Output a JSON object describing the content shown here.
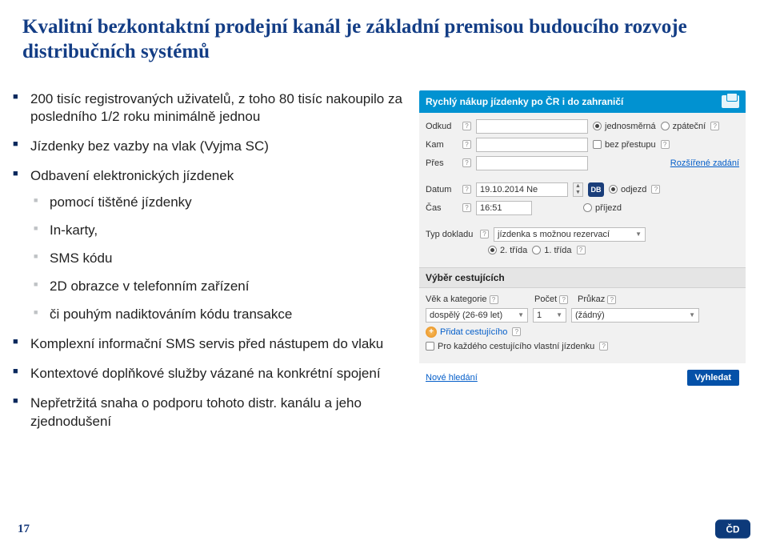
{
  "title": "Kvalitní bezkontaktní  prodejní kanál je základní premisou budoucího rozvoje distribučních systémů",
  "bullets": {
    "b1": "200 tisíc registrovaných uživatelů, z toho 80 tisíc nakoupilo za posledního 1/2 roku minimálně jednou",
    "b2": "Jízdenky bez vazby na vlak (Vyjma SC)",
    "b3": "Odbavení elektronických jízdenek",
    "sub": {
      "s1": "pomocí tištěné jízdenky",
      "s2": "In-karty,",
      "s3": "SMS kódu",
      "s4": "2D obrazce v telefonním zařízení",
      "s5": "či pouhým nadiktováním kódu transakce"
    },
    "b4": "Komplexní informační SMS servis před nástupem do vlaku",
    "b5": "Kontextové doplňkové služby vázané na konkrétní spojení",
    "b6": "Nepřetržitá snaha o podporu tohoto distr. kanálu a jeho zjednodušení"
  },
  "form": {
    "header": "Rychlý nákup jízdenky po ČR i do zahraničí",
    "labels": {
      "odkud": "Odkud",
      "kam": "Kam",
      "pres": "Přes",
      "datum": "Datum",
      "cas": "Čas",
      "typ": "Typ dokladu",
      "vek": "Věk a kategorie",
      "pocet": "Počet",
      "prukaz": "Průkaz"
    },
    "options": {
      "jednosmerna": "jednosměrná",
      "zpatecni": "zpáteční",
      "bezprestupu": "bez přestupu",
      "rozsirene": "Rozšířené zadání",
      "odjezd": "odjezd",
      "prijezd": "příjezd",
      "trida2": "2. třída",
      "trida1": "1. třída"
    },
    "values": {
      "datum": "19.10.2014 Ne",
      "cas": "16:51",
      "db": "DB",
      "typdokladu": "jízdenka s možnou rezervací",
      "vek": "dospělý (26-69 let)",
      "pocet": "1",
      "prukaz": "(žádný)"
    },
    "sections": {
      "vyber": "Výběr cestujících"
    },
    "links": {
      "pridat": "Přidat cestujícího",
      "novehledani": "Nové hledání"
    },
    "checkbox": "Pro každého cestujícího vlastní jízdenku",
    "button": "Vyhledat"
  },
  "pageNumber": "17"
}
